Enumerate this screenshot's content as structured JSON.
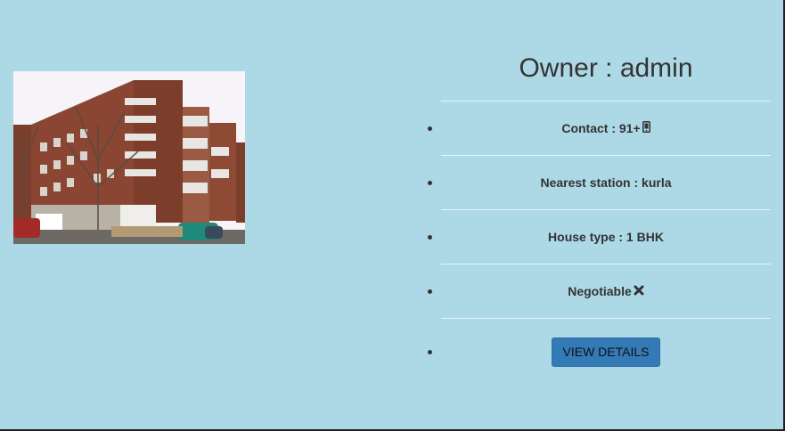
{
  "listing": {
    "image_alt": "apartment building photo",
    "owner_text": "Owner : admin",
    "contact_text": "Contact : 91+",
    "contact_icon": "mobile-phone-icon",
    "station_text": "Nearest station : kurla",
    "house_type_text": "House type : 1 BHK",
    "negotiable_text": "Negotiable",
    "negotiable_icon": "cross-icon",
    "button_label": "VIEW DETAILS"
  },
  "colors": {
    "background": "#add8e6",
    "button": "#337ab7",
    "text": "#333333"
  }
}
